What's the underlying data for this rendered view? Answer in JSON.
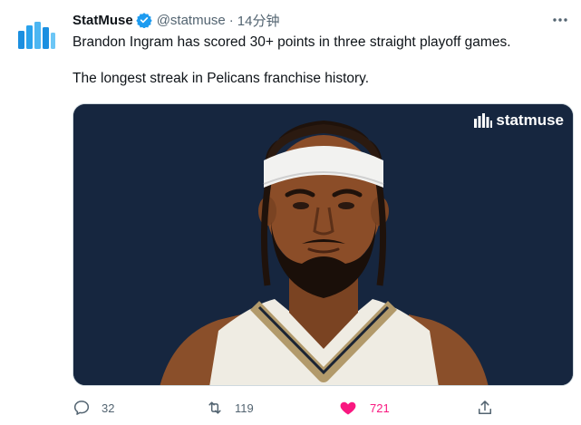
{
  "tweet": {
    "author_name": "StatMuse",
    "handle": "@statmuse",
    "separator": "·",
    "time": "14分钟",
    "text_lines": [
      "Brandon Ingram has scored 30+ points in three straight playoff games.",
      "The longest streak in Pelicans franchise history."
    ],
    "media": {
      "brand_label": "statmuse",
      "background_color": "#16263f"
    },
    "stats": {
      "replies": "32",
      "retweets": "119",
      "likes": "721"
    },
    "icons": {
      "avatar": "statmuse-logo-icon",
      "verified": "verified-badge-icon",
      "more": "more-icon",
      "reply": "reply-icon",
      "retweet": "retweet-icon",
      "like": "heart-icon",
      "share": "share-icon"
    },
    "colors": {
      "brand_blue": "#1d9bf0",
      "like_pink": "#f91880",
      "muted": "#536471"
    }
  }
}
